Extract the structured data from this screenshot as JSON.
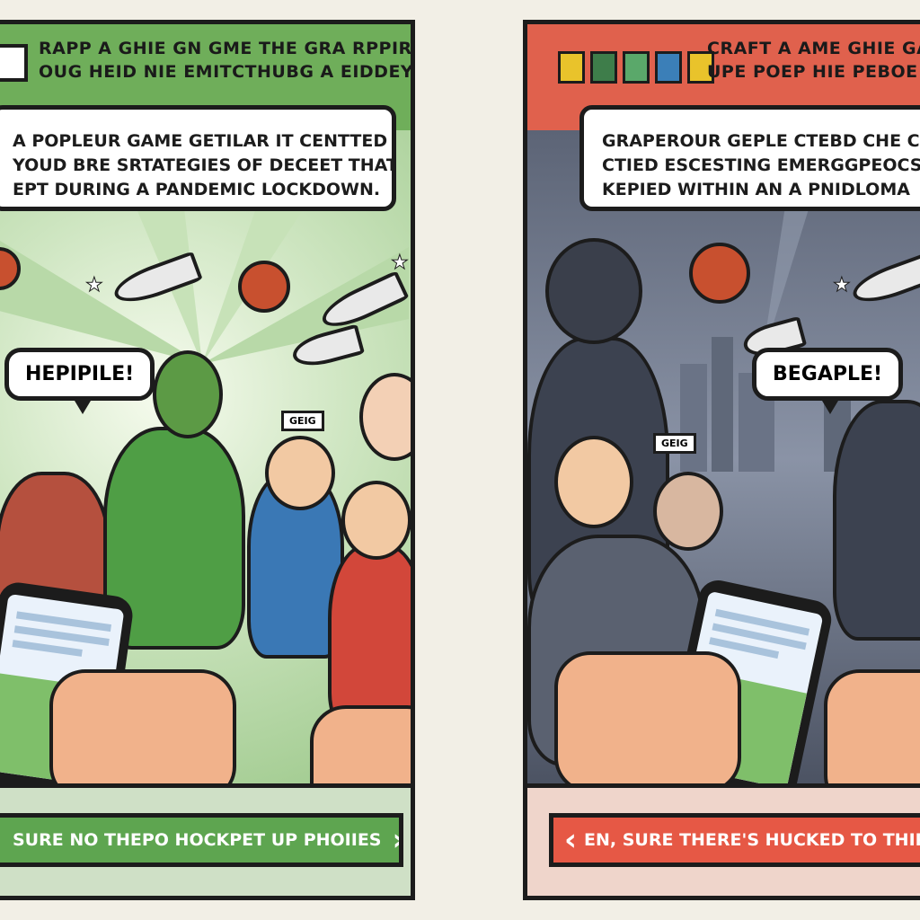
{
  "left_panel": {
    "banner_line1": "RAPP A GHIE GN GME THE GRA RPPIRC N",
    "banner_line2": "OUG HEID NIE EMITCTHUBG A EIDDEY GAMES.",
    "caption_line1": "A POPLEUR GAME GETILAR IT CENTTED",
    "caption_line2": "YOUD BRE SRTATEGIES OF DECEET THAT",
    "caption_line3": "EPT DURING A PANDEMIC LOCKDOWN.",
    "speech": "HEPIPILE!",
    "sign": "GEIG",
    "cta_label": "SURE NO THEPO HOCKPET UP PHOIIES",
    "cta_icon": "chevron-right-icon",
    "accent": "#6fae5a"
  },
  "right_panel": {
    "banner_line1": "CRAFT A AME GHIE GAME",
    "banner_line2": "UPE POEP HIE PEBOE GA",
    "caption_line1": "GRAPEROUR GEPLE CTEBD CHE CR",
    "caption_line2": "CTIED ESCESTING EMERGGPEOCS GAT",
    "caption_line3": "KEPIED WITHIN AN A PNIDLOMA",
    "speech": "BEGAPLE!",
    "sign": "GEIG",
    "cta_label": "EN, SURE THERE'S HUCKED TO THIR",
    "cta_icon": "chevron-left-icon",
    "accent": "#e0614d",
    "swatches": [
      "#e9c32b",
      "#3e7d4a",
      "#5aa86a",
      "#3b7fb8",
      "#e9c32b"
    ]
  }
}
